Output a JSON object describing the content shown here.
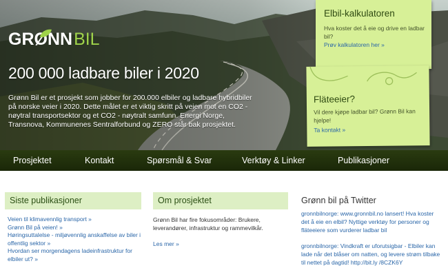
{
  "brand": {
    "logo_main": "GRØNN",
    "logo_accent": "BIL",
    "accent_color": "#9fd34a",
    "nav_color": "#1f2e0b",
    "note_color": "#d7f097"
  },
  "hero": {
    "headline": "200 000 ladbare biler i 2020",
    "intro": "Grønn Bil er et prosjekt som jobber for 200.000 elbiler og ladbare hybridbiler på norske veier i 2020. Dette målet er et viktig skritt på veien mot en CO2 - nøytral transportsektor og et CO2 - nøytralt samfunn. Energi Norge, Transnova, Kommunenes Sentralforbund og ZERO står bak prosjektet."
  },
  "notes": {
    "calculator": {
      "title": "Elbil-kalkulatoren",
      "text": "Hva koster det å eie og drive en ladbar bil?",
      "link": "Prøv kalkulatoren her »"
    },
    "owner": {
      "title": "Fläteeier?",
      "text": "Vil dere kjøpe ladbar bil? Grønn Bil kan hjelpe!",
      "link": "Ta kontakt »"
    }
  },
  "nav": {
    "items": [
      "Prosjektet",
      "Kontakt",
      "Spørsmål & Svar",
      "Verktøy & Linker",
      "Publikasjoner"
    ]
  },
  "publications": {
    "heading": "Siste publikasjoner",
    "items": [
      "Veien til klimavennlig transport »",
      "Grønn Bil på veien! »",
      "Høringsuttalelse - miljøvennlig anskaffelse av biler i offentlig sektor »",
      "Hvordan ser morgendagens ladeinfrastruktur for elbiler ut? »"
    ]
  },
  "about": {
    "heading": "Om prosjektet",
    "text": "Grønn Bil har fire fokusområder: Brukere, leverandører, infrastruktur og rammevilkår.",
    "more": "Les mer »"
  },
  "twitter": {
    "heading": "Grønn bil på Twitter",
    "tweets": [
      "gronnbilnorge: www.gronnbil.no lansert! Hva koster det å eie en elbil? Nyttige verktøy for personer og fläteeiere som vurderer ladbar bil",
      "gronnbilnorge: Vindkraft er uforutsigbar - Elbiler kan lade når det blåser om natten, og levere strøm tilbake til nettet på dagtid! http://bit.ly /8CZK6Y"
    ]
  }
}
